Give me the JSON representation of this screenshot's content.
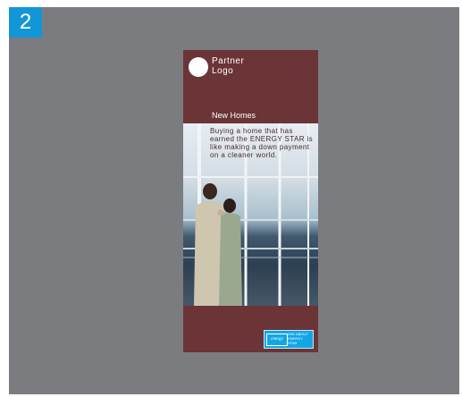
{
  "page_badge": "2",
  "brochure": {
    "logo_line1": "Partner",
    "logo_line2": "Logo",
    "title": "New Homes",
    "tagline": "Buying a home that has earned the ENERGY STAR is like making a down payment on a cleaner world.",
    "badge_logo": "energy",
    "badge_line1": "ASK ABOUT",
    "badge_line2": "ENERGY",
    "badge_line3": "STAR"
  },
  "colors": {
    "panel_bg": "#7b7c80",
    "badge_blue": "#1296d8",
    "brochure_maroon": "#6b3436",
    "energy_star_blue": "#13a6e5"
  }
}
